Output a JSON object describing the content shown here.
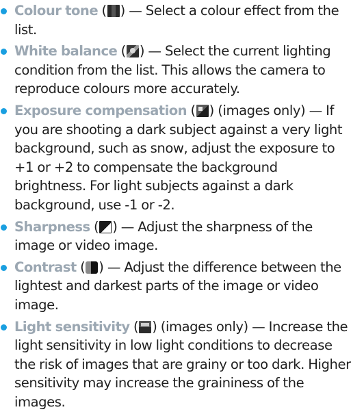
{
  "items": [
    {
      "term": "Colour tone",
      "icon": "colour-tone-icon",
      "pre_note": "",
      "description": "— Select a colour effect from the list."
    },
    {
      "term": "White balance",
      "icon": "white-balance-icon",
      "pre_note": "",
      "description": "— Select the current lighting condition from the list. This allows the camera to reproduce colours more accurately."
    },
    {
      "term": "Exposure compensation",
      "icon": "exposure-compensation-icon",
      "pre_note": "(images only)",
      "description": "— If you are shooting a dark subject against a very light background, such as snow, adjust the exposure to +1 or +2 to compensate the background brightness. For light subjects against a dark background, use -1 or -2."
    },
    {
      "term": "Sharpness",
      "icon": "sharpness-icon",
      "pre_note": "",
      "description": "— Adjust the sharpness of the image or video image."
    },
    {
      "term": "Contrast",
      "icon": "contrast-icon",
      "pre_note": "",
      "description": "— Adjust the difference between the lightest and darkest parts of the image or video image."
    },
    {
      "term": "Light sensitivity",
      "icon": "light-sensitivity-icon",
      "pre_note": "(images only)",
      "description": "— Increase the light sensitivity in low light conditions to decrease the risk of images that are grainy or too dark. Higher sensitivity may increase the graininess of the images."
    }
  ],
  "colors": {
    "bullet": "#1a9fe0",
    "term": "#9ba7b2",
    "body_text": "#1f1f1f"
  }
}
